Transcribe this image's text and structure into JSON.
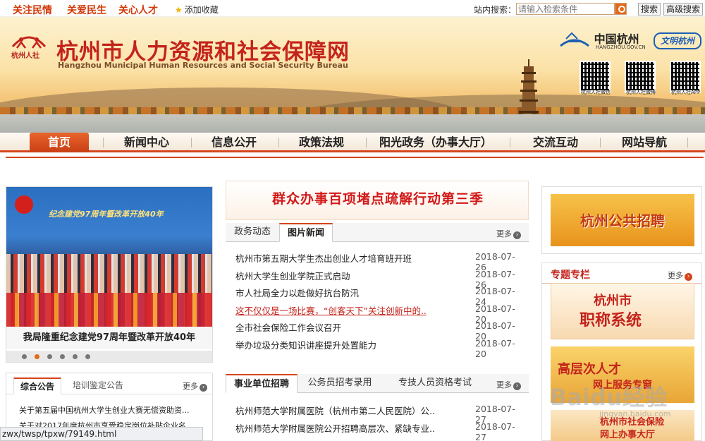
{
  "topbar": {
    "slogans": [
      "关注民情",
      "关爱民生",
      "关心人才"
    ],
    "add_favorite": "添加收藏",
    "search_label": "站内搜索：",
    "search_placeholder": "请输入检索条件",
    "search_button": "搜索",
    "advanced_search_button": "高级搜索"
  },
  "banner": {
    "logo_text": "杭州人社",
    "title": "杭州市人力资源和社会保障网",
    "subtitle": "Hangzhou Municipal Human Resources and Social Security Bureau",
    "partner_name": "中国杭州",
    "partner_url": "HANGZHOU.GOV.CN",
    "wenming": "文明杭州",
    "qr_captions": [
      "杭州人社微信",
      "杭州人社微博",
      "杭州人社APP"
    ]
  },
  "nav": {
    "items": [
      "首页",
      "新闻中心",
      "信息公开",
      "政策法规",
      "阳光政务（办事大厅）",
      "交流互动",
      "网站导航"
    ],
    "active_index": 0
  },
  "slider": {
    "stage_text": "纪念建党97周年暨改革开放40年",
    "caption": "我局隆重纪念建党97周年暨改革开放40年",
    "dot_count": 6,
    "active_dot": 1
  },
  "notice": {
    "tabs": [
      "综合公告",
      "培训鉴定公告"
    ],
    "more": "更多",
    "items": [
      "关于第五届中国杭州大学生创业大赛无偿资助资...",
      "关于对2017年度杭州市享受稳定岗位补贴企业名..."
    ]
  },
  "headline": "群众办事百项堵点疏解行动第三季",
  "news": {
    "tabs": [
      "政务动态",
      "图片新闻"
    ],
    "active_tab": 1,
    "more": "更多",
    "items": [
      {
        "title": "杭州市第五期大学生杰出创业人才培育班开班",
        "date": "2018-07-26",
        "highlight": false
      },
      {
        "title": "杭州大学生创业学院正式启动",
        "date": "2018-07-26",
        "highlight": false
      },
      {
        "title": "市人社局全力以赴做好抗台防汛",
        "date": "2018-07-24",
        "highlight": false
      },
      {
        "title": "这不仅仅是一场比赛，“创客天下”关注创新中的..",
        "date": "2018-07-20",
        "highlight": true
      },
      {
        "title": "全市社会保险工作会议召开",
        "date": "2018-07-20",
        "highlight": false
      },
      {
        "title": "举办垃圾分类知识讲座提升处置能力",
        "date": "2018-07-20",
        "highlight": false
      }
    ]
  },
  "recruit": {
    "tabs": [
      "事业单位招聘",
      "公务员招考录用",
      "专技人员资格考试"
    ],
    "active_tab": 0,
    "more": "更多",
    "items": [
      {
        "title": "杭州师范大学附属医院（杭州市第二人民医院）公..",
        "date": "2018-07-27"
      },
      {
        "title": "杭州师范大学附属医院公开招聘高层次、紧缺专业..",
        "date": "2018-07-27"
      }
    ]
  },
  "right": {
    "recruit_banner": "杭州公共招聘",
    "special_title": "专题专栏",
    "more": "更多",
    "banner1_line1": "杭州市",
    "banner1_line2": "职称系统",
    "banner2_line1": "高层次人才",
    "banner2_line2": "网上服务专窗",
    "banner3_line1": "杭州市社会保险",
    "banner3_line2": "网上办事大厅"
  },
  "watermark": {
    "main": "Baidu经验",
    "sub": "jingyan.baidu.com"
  },
  "status_url": "zwx/twsp/tpxw/79149.html",
  "colors": {
    "accent": "#d6451b",
    "brand_red": "#c4231b",
    "orange": "#e26a1a"
  }
}
